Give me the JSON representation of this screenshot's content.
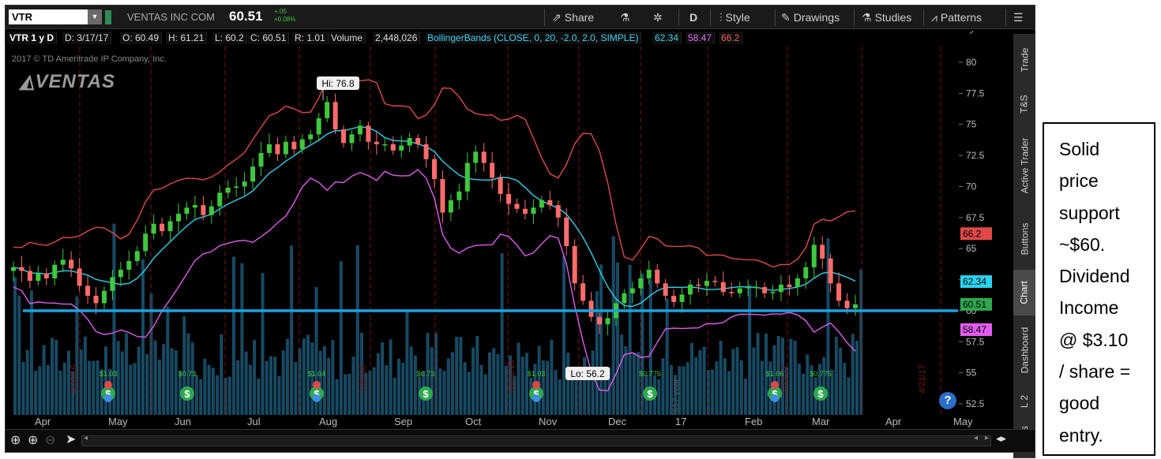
{
  "toolbar": {
    "symbol": "VTR",
    "company": "VENTAS INC COM",
    "last_price": "60.51",
    "change_top": "+.05",
    "change_bottom": "+0.08%",
    "share_label": "Share",
    "period_label": "D",
    "style_label": "Style",
    "drawings_label": "Drawings",
    "studies_label": "Studies",
    "patterns_label": "Patterns"
  },
  "infobar": {
    "symbol_period": "VTR 1 y D",
    "date": "D: 3/17/17",
    "open": "O: 60.49",
    "high": "H: 61.21",
    "low": "L: 60.2",
    "close": "C: 60.51",
    "range": "R: 1.01",
    "volume_label": "Volume",
    "volume_value": "2,448,026",
    "study": "BollingerBands (CLOSE, 0, 20, -2.0, 2.0, SIMPLE)",
    "bb_mid": "62.34",
    "bb_low": "58.47",
    "bb_high": "66.2"
  },
  "watermark": {
    "copyright": "2017 © TD Ameritrade IP Company, Inc.",
    "logo": "VENTAS"
  },
  "chart_data": {
    "type": "candlestick",
    "ylim": [
      52.5,
      80
    ],
    "yticks": [
      "80",
      "77.5",
      "75",
      "72.5",
      "70",
      "67.5",
      "65",
      "62.5",
      "60",
      "57.5",
      "55",
      "52.5"
    ],
    "x_labels": [
      "Apr",
      "May",
      "Jun",
      "Jul",
      "Aug",
      "Sep",
      "Oct",
      "Nov",
      "Dec",
      "17",
      "Feb",
      "Mar",
      "Apr",
      "May"
    ],
    "high_label": "Hi: 76.8",
    "low_label": "Lo: 56.2",
    "price_tags": [
      {
        "label": "66.2",
        "value": 66.2,
        "color": "#e04848"
      },
      {
        "label": "62.34",
        "value": 62.34,
        "color": "#2ad2ee"
      },
      {
        "label": "60.51",
        "value": 60.51,
        "color": "#2fa84f"
      },
      {
        "label": "58.47",
        "value": 58.47,
        "color": "#e25bef"
      }
    ],
    "dividend_labels": [
      "$1.03",
      "$0.73",
      "$1.04",
      "$0.73",
      "$1.03",
      "$0.775",
      "$1.06",
      "$0.775"
    ],
    "earnings_labels": [
      "4/28/16",
      "7/29/16",
      "10/21/16",
      "2/13/17",
      "4/21/17"
    ],
    "year_label": "2017 year",
    "close_series": [
      63.5,
      63.2,
      62.4,
      63,
      62.6,
      63.7,
      64.1,
      63.4,
      62,
      61.2,
      60.6,
      61.6,
      62.7,
      63.3,
      64,
      64.8,
      66.2,
      67,
      66.4,
      67.2,
      67.8,
      68.3,
      68.5,
      67.7,
      68.4,
      69.5,
      69.9,
      70,
      70.4,
      71.6,
      72.7,
      73.4,
      72.6,
      73.6,
      73,
      73.8,
      74.2,
      75.5,
      76.8,
      74.6,
      73.5,
      74.2,
      74.9,
      73.6,
      73.4,
      73.4,
      72.9,
      73.3,
      73.9,
      73.4,
      72.2,
      70.6,
      67.9,
      68.9,
      69.6,
      71.9,
      72.8,
      71.9,
      70.7,
      69.4,
      68.6,
      68.2,
      67.8,
      68.3,
      68.9,
      68.5,
      67.5,
      65.2,
      62.2,
      60.8,
      59.5,
      58.9,
      59.4,
      60.6,
      61.4,
      61.8,
      62.6,
      63.3,
      62.2,
      61.2,
      60.7,
      61.3,
      62.1,
      62,
      62.4,
      62.3,
      61.5,
      61.4,
      61.8,
      61.9,
      61.9,
      61.4,
      61.5,
      62.1,
      61.9,
      62.6,
      63.5,
      65.3,
      64.2,
      62.2,
      60.8,
      60.2,
      60.51
    ]
  },
  "annotation": {
    "lines": [
      "Solid",
      "price",
      "support",
      "~$60.",
      "Dividend",
      "Income",
      "@ $3.10",
      "/ share =",
      "good",
      "entry."
    ]
  },
  "side_tabs": [
    "Trade",
    "T&S",
    "Active Trader",
    "Buttons",
    "Chart",
    "Dashboard",
    "L 2",
    "News"
  ]
}
